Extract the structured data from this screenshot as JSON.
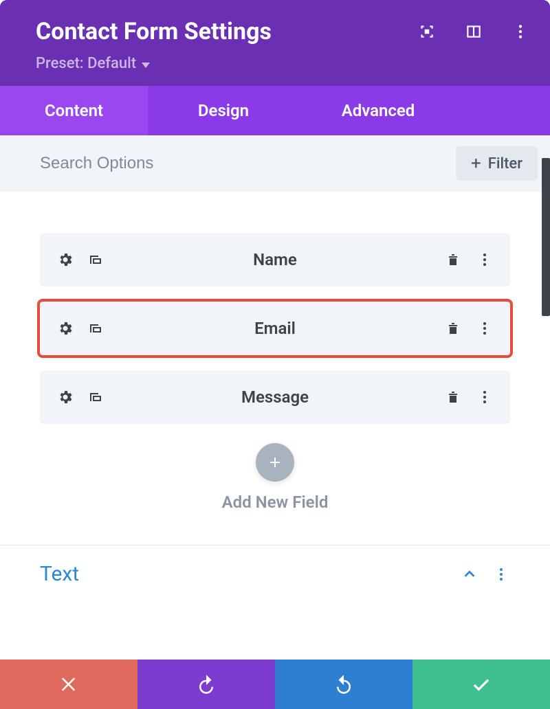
{
  "header": {
    "title": "Contact Form Settings",
    "preset_label": "Preset: Default"
  },
  "tabs": {
    "content": "Content",
    "design": "Design",
    "advanced": "Advanced"
  },
  "search": {
    "placeholder": "Search Options",
    "filter_label": "Filter"
  },
  "fields": [
    {
      "label": "Name",
      "highlighted": false
    },
    {
      "label": "Email",
      "highlighted": true
    },
    {
      "label": "Message",
      "highlighted": false
    }
  ],
  "add_new_label": "Add New Field",
  "sections": {
    "text": "Text"
  }
}
